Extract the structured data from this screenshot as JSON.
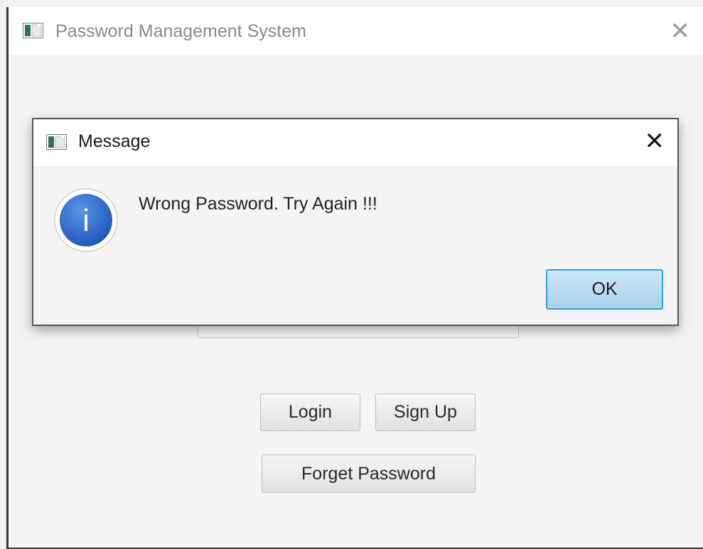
{
  "main_window": {
    "title": "Password Management System",
    "close_glyph": "✕",
    "icon": "app-window-icon",
    "buttons": {
      "login": "Login",
      "sign_up": "Sign Up",
      "forget_password": "Forget Password"
    }
  },
  "dialog": {
    "title": "Message",
    "close_glyph": "✕",
    "icon": "app-window-icon",
    "message_icon": "info-icon",
    "message": "Wrong Password. Try Again !!!",
    "ok_label": "OK",
    "info_glyph": "i"
  },
  "colors": {
    "info_blue": "#2f6fd0",
    "ok_border": "#3c9ad6",
    "ok_fill": "#b9dcef"
  }
}
